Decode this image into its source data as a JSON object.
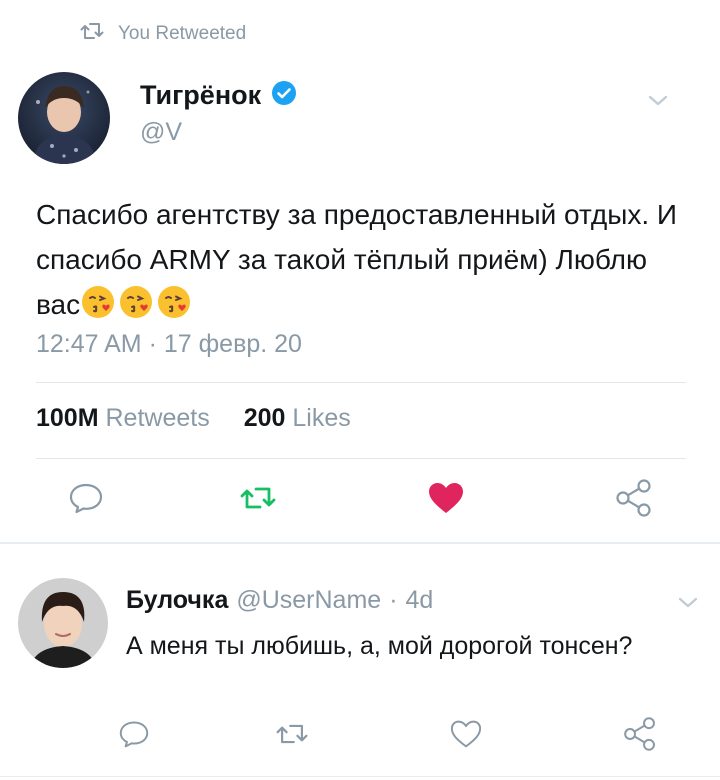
{
  "retweet_banner": {
    "label": "You Retweeted",
    "icon": "retweet-icon"
  },
  "tweet": {
    "author_name": "Тигрёнок",
    "verified": true,
    "handle": "@V",
    "text": "Спасибо агентству за предоставленный отдых. И спасибо ARMY за такой тёплый приём) Люблю вас",
    "emojis": [
      "kissing-face-icon",
      "kissing-face-icon",
      "kissing-face-icon"
    ],
    "timestamp": "12:47 AM · 17 февр. 20",
    "retweets_count": "100M",
    "retweets_label": "Retweets",
    "likes_count": "200",
    "likes_label": "Likes",
    "liked": true,
    "colors": {
      "retweet_active": "#17bf63",
      "like_active": "#e0245e",
      "verified": "#1da1f2"
    }
  },
  "reply": {
    "author_name": "Булочка",
    "handle": "@UserName",
    "separator": "·",
    "age": "4d",
    "text": "А меня ты любишь, а, мой дорогой тонсен?"
  }
}
